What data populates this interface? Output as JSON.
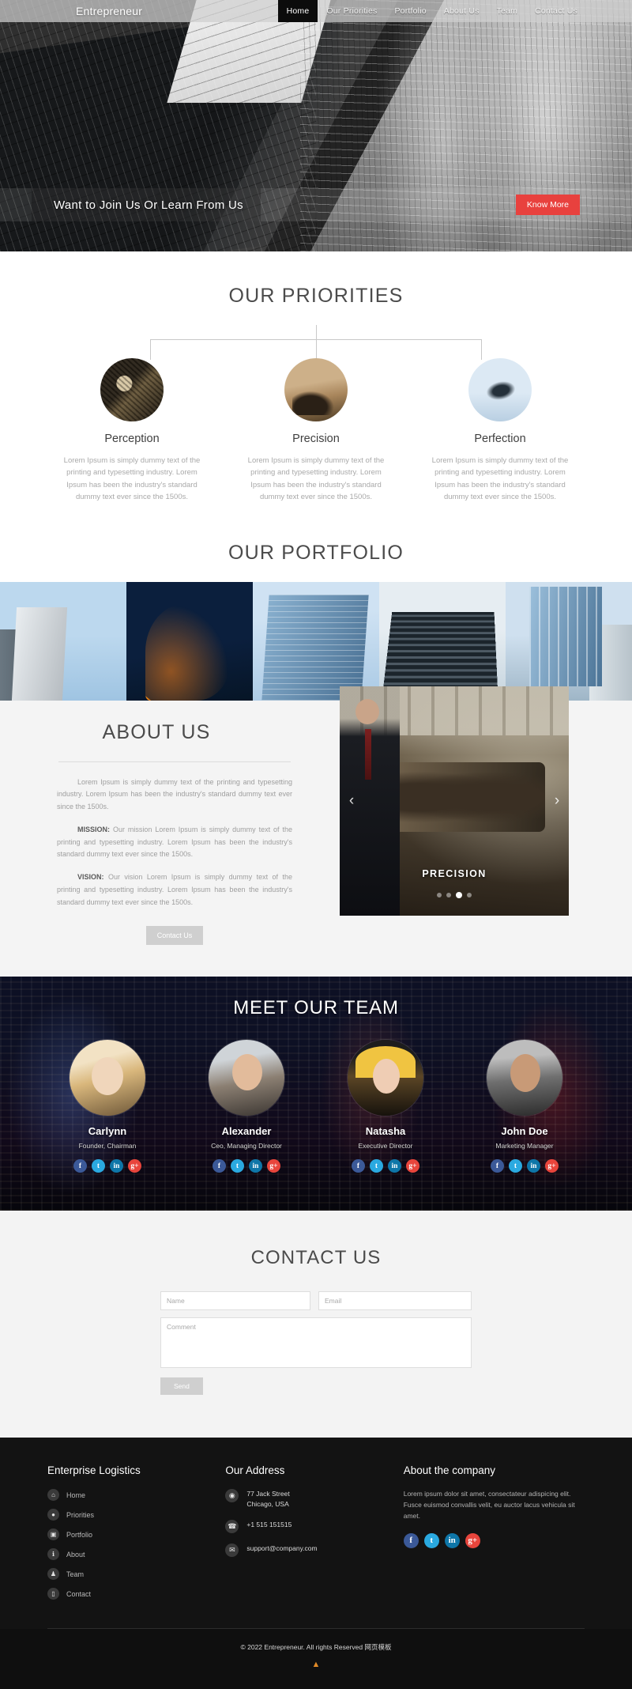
{
  "header": {
    "brand": "Entrepreneur",
    "nav": [
      {
        "label": "Home",
        "active": true
      },
      {
        "label": "Our Priorities",
        "active": false
      },
      {
        "label": "Portfolio",
        "active": false
      },
      {
        "label": "About Us",
        "active": false
      },
      {
        "label": "Team",
        "active": false
      },
      {
        "label": "Contact Us",
        "active": false
      }
    ]
  },
  "hero": {
    "cta_text": "Want to Join Us Or Learn From Us",
    "button_label": "Know More",
    "button_color": "#e8413e"
  },
  "priorities": {
    "title": "OUR PRIORITIES",
    "items": [
      {
        "name": "Perception",
        "text": "Lorem Ipsum is simply dummy text of the printing and typesetting industry. Lorem Ipsum has been the industry's standard dummy text ever since the 1500s."
      },
      {
        "name": "Precision",
        "text": "Lorem Ipsum is simply dummy text of the printing and typesetting industry. Lorem Ipsum has been the industry's standard dummy text ever since the 1500s."
      },
      {
        "name": "Perfection",
        "text": "Lorem Ipsum is simply dummy text of the printing and typesetting industry. Lorem Ipsum has been the industry's standard dummy text ever since the 1500s."
      }
    ]
  },
  "portfolio": {
    "title": "OUR PORTFOLIO",
    "item_count": 5
  },
  "about": {
    "title": "ABOUT US",
    "intro": "Lorem Ipsum is simply dummy text of the printing and typesetting industry. Lorem Ipsum has been the industry's standard dummy text ever since the 1500s.",
    "mission_label": "MISSION:",
    "mission_text": " Our mission Lorem Ipsum is simply dummy text of the printing and typesetting industry. Lorem Ipsum has been the industry's standard dummy text ever since the 1500s.",
    "vision_label": "VISION:",
    "vision_text": " Our vision Lorem Ipsum is simply dummy text of the printing and typesetting industry. Lorem Ipsum has been the industry's standard dummy text ever since the 1500s.",
    "button_label": "Contact Us",
    "carousel": {
      "caption": "PRECISION",
      "prev_icon": "chevron-left-icon",
      "next_icon": "chevron-right-icon",
      "dot_count": 4,
      "active_dot": 3
    }
  },
  "team": {
    "title": "MEET OUR TEAM",
    "members": [
      {
        "name": "Carlynn",
        "role": "Founder, Chairman"
      },
      {
        "name": "Alexander",
        "role": "Ceo, Managing Director"
      },
      {
        "name": "Natasha",
        "role": "Executive Director"
      },
      {
        "name": "John Doe",
        "role": "Marketing Manager"
      }
    ],
    "social_icons": [
      "facebook-icon",
      "twitter-icon",
      "linkedin-icon",
      "googleplus-icon"
    ]
  },
  "contact": {
    "title": "CONTACT US",
    "name_placeholder": "Name",
    "email_placeholder": "Email",
    "comment_placeholder": "Comment",
    "name_value": "",
    "email_value": "",
    "comment_value": "",
    "send_label": "Send"
  },
  "footer": {
    "links_title": "Enterprise Logistics",
    "links": [
      {
        "label": "Home",
        "icon": "home-icon",
        "glyph": "⌂"
      },
      {
        "label": "Priorities",
        "icon": "circle-dot-icon",
        "glyph": "●"
      },
      {
        "label": "Portfolio",
        "icon": "image-icon",
        "glyph": "▣"
      },
      {
        "label": "About",
        "icon": "info-icon",
        "glyph": "ℹ"
      },
      {
        "label": "Team",
        "icon": "user-icon",
        "glyph": "♟"
      },
      {
        "label": "Contact",
        "icon": "mobile-icon",
        "glyph": "▯"
      }
    ],
    "address_title": "Our Address",
    "address": [
      {
        "icon": "map-pin-icon",
        "glyph": "◉",
        "line1": "77 Jack Street",
        "line2": "Chicago, USA"
      },
      {
        "icon": "phone-icon",
        "glyph": "☎",
        "line1": "+1 515 151515",
        "line2": ""
      },
      {
        "icon": "envelope-icon",
        "glyph": "✉",
        "line1": "support@company.com",
        "line2": ""
      }
    ],
    "about_title": "About the company",
    "about_text": "Lorem ipsum dolor sit amet, consectateur adispicing elit. Fusce euismod convallis velit, eu auctor lacus vehicula sit amet.",
    "social_icons": [
      "facebook-icon",
      "twitter-icon",
      "linkedin-icon",
      "googleplus-icon"
    ],
    "copyright": "© 2022 Entrepreneur. All rights Reserved 网页模板",
    "to_top_icon": "chevron-up-icon",
    "to_top_color": "#e08a27"
  }
}
